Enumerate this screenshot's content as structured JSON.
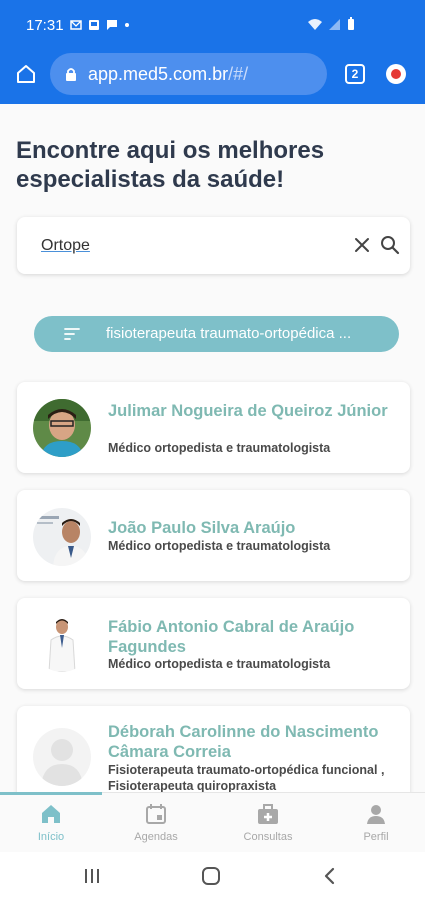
{
  "status_bar": {
    "time": "17:31"
  },
  "browser": {
    "url_host": "app.med5.com.br",
    "url_path": "/#/",
    "tab_count": "2"
  },
  "page": {
    "headline": "Encontre aqui os melhores especialistas da saúde!",
    "search": {
      "value": "Ortope"
    },
    "filter_label": "fisioterapeuta traumato-ortopédica ..."
  },
  "doctors": [
    {
      "name": "Julimar Nogueira de Queiroz Júnior",
      "specialty": "Médico ortopedista e traumatologista"
    },
    {
      "name": "João Paulo Silva Araújo",
      "specialty": "Médico ortopedista e traumatologista"
    },
    {
      "name": "Fábio Antonio Cabral de Araújo Fagundes",
      "specialty": "Médico ortopedista e traumatologista"
    },
    {
      "name": "Déborah Carolinne do Nascimento Câmara Correia",
      "specialty": "Fisioterapeuta traumato-ortopédica funcional , Fisioterapeuta quiropraxista"
    }
  ],
  "bottom_nav": [
    {
      "label": "Início",
      "icon": "home-icon",
      "active": true
    },
    {
      "label": "Agendas",
      "icon": "calendar-icon",
      "active": false
    },
    {
      "label": "Consultas",
      "icon": "medical-bag-icon",
      "active": false
    },
    {
      "label": "Perfil",
      "icon": "person-icon",
      "active": false
    }
  ],
  "colors": {
    "browser_bar": "#1a73e8",
    "accent_teal": "#7ec0c9",
    "doctor_name": "#7fb9b2",
    "headline": "#2f3a4d"
  }
}
